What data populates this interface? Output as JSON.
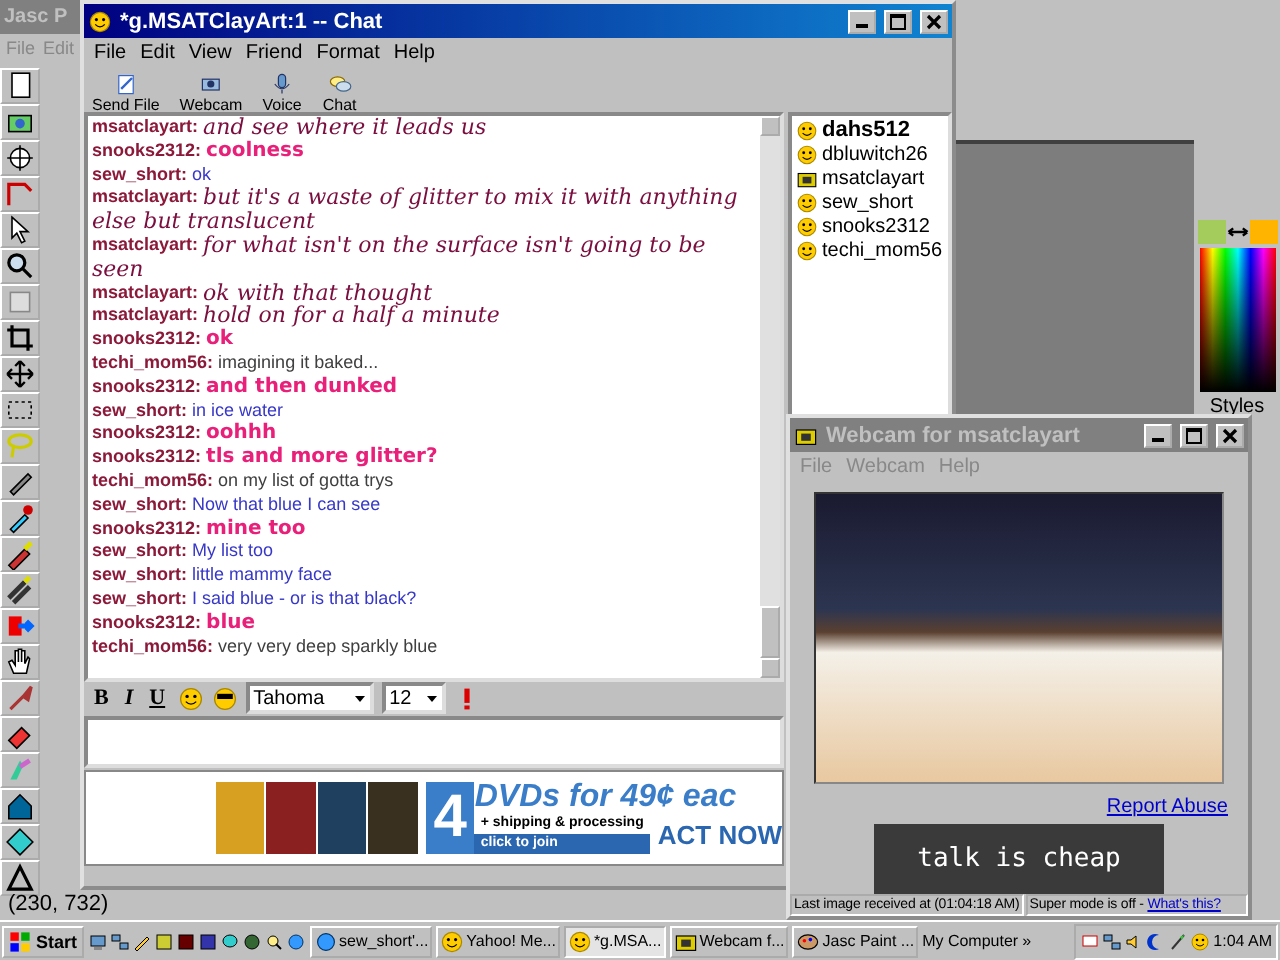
{
  "paint_window": {
    "title": "Jasc P",
    "menu": [
      "File",
      "Edit"
    ],
    "styles_label": "Styles",
    "status": "(230, 732)"
  },
  "chat_window": {
    "title": "*g.MSATClayArt:1 -- Chat",
    "menu": [
      "File",
      "Edit",
      "View",
      "Friend",
      "Format",
      "Help"
    ],
    "toolbar": [
      {
        "label": "Send File",
        "kind": "file"
      },
      {
        "label": "Webcam",
        "kind": "webcam"
      },
      {
        "label": "Voice",
        "kind": "voice"
      },
      {
        "label": "Chat",
        "kind": "chat"
      }
    ],
    "messages": [
      {
        "user": "msatclayart:",
        "text": "and see where it leads us",
        "kind": "script"
      },
      {
        "user": "snooks2312:",
        "text": "coolness",
        "kind": "comic"
      },
      {
        "user": "sew_short:",
        "text": "ok",
        "kind": "blue"
      },
      {
        "user": "msatclayart:",
        "text": "but it's a waste of glitter to mix it with anything else but translucent",
        "kind": "script"
      },
      {
        "user": "msatclayart:",
        "text": "for what isn't on the surface isn't going to be seen",
        "kind": "script"
      },
      {
        "user": "msatclayart:",
        "text": "ok with that thought",
        "kind": "script"
      },
      {
        "user": "msatclayart:",
        "text": "hold on for a half a minute",
        "kind": "script"
      },
      {
        "user": "snooks2312:",
        "text": "ok",
        "kind": "comic"
      },
      {
        "user": "techi_mom56:",
        "text": "imagining it baked...",
        "kind": "plain"
      },
      {
        "user": "snooks2312:",
        "text": "and then dunked",
        "kind": "comic"
      },
      {
        "user": "sew_short:",
        "text": "in ice water",
        "kind": "blue"
      },
      {
        "user": "snooks2312:",
        "text": "oohhh",
        "kind": "comic"
      },
      {
        "user": "snooks2312:",
        "text": "tls and more glitter?",
        "kind": "comic"
      },
      {
        "user": "techi_mom56:",
        "text": "on my list of gotta trys",
        "kind": "plain"
      },
      {
        "user": "sew_short:",
        "text": "Now that blue I can see",
        "kind": "blue"
      },
      {
        "user": "snooks2312:",
        "text": "mine too",
        "kind": "comic"
      },
      {
        "user": "sew_short:",
        "text": "My list too",
        "kind": "blue"
      },
      {
        "user": "sew_short:",
        "text": "little mammy face",
        "kind": "blue"
      },
      {
        "user": "sew_short:",
        "text": "I said blue - or is that black?",
        "kind": "blue"
      },
      {
        "user": "snooks2312:",
        "text": "blue",
        "kind": "comic"
      },
      {
        "user": "techi_mom56:",
        "text": "very very deep sparkly blue",
        "kind": "plain"
      }
    ],
    "users": [
      {
        "name": "dahs512",
        "bold": true,
        "kind": "smiley"
      },
      {
        "name": "dbluwitch26",
        "bold": false,
        "kind": "smiley"
      },
      {
        "name": "msatclayart",
        "bold": false,
        "kind": "webcam"
      },
      {
        "name": "sew_short",
        "bold": false,
        "kind": "smiley"
      },
      {
        "name": "snooks2312",
        "bold": false,
        "kind": "smiley"
      },
      {
        "name": "techi_mom56",
        "bold": false,
        "kind": "smiley"
      }
    ],
    "format_bar": {
      "bold": "B",
      "italic": "I",
      "underline": "U",
      "font": "Tahoma",
      "size": "12"
    },
    "ad": {
      "digit": "4",
      "headline": "DVDs for 49¢ eac",
      "shipping": "+ shipping & processing",
      "join": "click to join",
      "cta": "ACT NOW"
    }
  },
  "webcam_window": {
    "title": "Webcam for msatclayart",
    "menu": [
      "File",
      "Webcam",
      "Help"
    ],
    "report_link": "Report Abuse",
    "banner": "talk is cheap",
    "status_left": "Last image received at (01:04:18 AM)",
    "status_right": "Super mode is off - ",
    "status_link": "What's this?"
  },
  "taskbar": {
    "start": "Start",
    "tasks": [
      {
        "label": "sew_short'...",
        "selected": false,
        "kind": "ie"
      },
      {
        "label": "Yahoo! Me...",
        "selected": false,
        "kind": "yahoo"
      },
      {
        "label": "*g.MSA...",
        "selected": true,
        "kind": "chat"
      },
      {
        "label": "Webcam f...",
        "selected": false,
        "kind": "webcam"
      },
      {
        "label": "Jasc Paint ...",
        "selected": false,
        "kind": "paint"
      }
    ],
    "address_label": "My Computer",
    "chevron": "»",
    "clock": "1:04 AM"
  }
}
